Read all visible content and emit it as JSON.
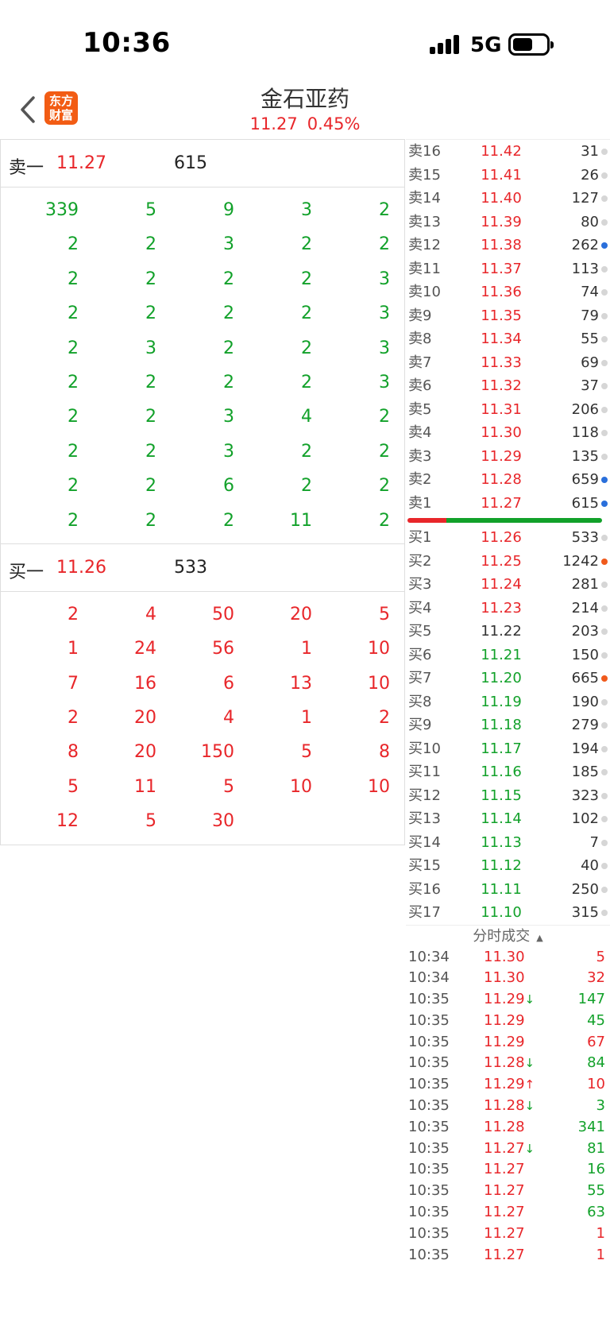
{
  "status_bar": {
    "time": "10:36",
    "network": "5G"
  },
  "header": {
    "logo_line1": "东方",
    "logo_line2": "财富",
    "stock_name": "金石亚药",
    "price": "11.27",
    "change_pct": "0.45%"
  },
  "sell1": {
    "label": "卖一",
    "price": "11.27",
    "volume": "615"
  },
  "sell_queue": [
    "339",
    "5",
    "9",
    "3",
    "2",
    "2",
    "2",
    "3",
    "2",
    "2",
    "2",
    "2",
    "2",
    "2",
    "3",
    "2",
    "2",
    "2",
    "2",
    "3",
    "2",
    "3",
    "2",
    "2",
    "3",
    "2",
    "2",
    "2",
    "2",
    "3",
    "2",
    "2",
    "3",
    "4",
    "2",
    "2",
    "2",
    "3",
    "2",
    "2",
    "2",
    "2",
    "6",
    "2",
    "2",
    "2",
    "2",
    "2",
    "11",
    "2"
  ],
  "buy1": {
    "label": "买一",
    "price": "11.26",
    "volume": "533"
  },
  "buy_queue": [
    "2",
    "4",
    "50",
    "20",
    "5",
    "1",
    "24",
    "56",
    "1",
    "10",
    "7",
    "16",
    "6",
    "13",
    "10",
    "2",
    "20",
    "4",
    "1",
    "2",
    "8",
    "20",
    "150",
    "5",
    "8",
    "5",
    "11",
    "5",
    "10",
    "10",
    "12",
    "5",
    "30"
  ],
  "asks": [
    {
      "label": "卖16",
      "price": "11.42",
      "vol": "31",
      "dot": "grey"
    },
    {
      "label": "卖15",
      "price": "11.41",
      "vol": "26",
      "dot": "grey"
    },
    {
      "label": "卖14",
      "price": "11.40",
      "vol": "127",
      "dot": "grey"
    },
    {
      "label": "卖13",
      "price": "11.39",
      "vol": "80",
      "dot": "grey"
    },
    {
      "label": "卖12",
      "price": "11.38",
      "vol": "262",
      "dot": "blue"
    },
    {
      "label": "卖11",
      "price": "11.37",
      "vol": "113",
      "dot": "grey"
    },
    {
      "label": "卖10",
      "price": "11.36",
      "vol": "74",
      "dot": "grey"
    },
    {
      "label": "卖9",
      "price": "11.35",
      "vol": "79",
      "dot": "grey"
    },
    {
      "label": "卖8",
      "price": "11.34",
      "vol": "55",
      "dot": "grey"
    },
    {
      "label": "卖7",
      "price": "11.33",
      "vol": "69",
      "dot": "grey"
    },
    {
      "label": "卖6",
      "price": "11.32",
      "vol": "37",
      "dot": "grey"
    },
    {
      "label": "卖5",
      "price": "11.31",
      "vol": "206",
      "dot": "grey"
    },
    {
      "label": "卖4",
      "price": "11.30",
      "vol": "118",
      "dot": "grey"
    },
    {
      "label": "卖3",
      "price": "11.29",
      "vol": "135",
      "dot": "grey"
    },
    {
      "label": "卖2",
      "price": "11.28",
      "vol": "659",
      "dot": "blue"
    },
    {
      "label": "卖1",
      "price": "11.27",
      "vol": "615",
      "dot": "blue"
    }
  ],
  "bids": [
    {
      "label": "买1",
      "price": "11.26",
      "vol": "533",
      "dot": "grey",
      "color": "red"
    },
    {
      "label": "买2",
      "price": "11.25",
      "vol": "1242",
      "dot": "orange",
      "color": "red"
    },
    {
      "label": "买3",
      "price": "11.24",
      "vol": "281",
      "dot": "grey",
      "color": "red"
    },
    {
      "label": "买4",
      "price": "11.23",
      "vol": "214",
      "dot": "grey",
      "color": "red"
    },
    {
      "label": "买5",
      "price": "11.22",
      "vol": "203",
      "dot": "grey",
      "color": "dark"
    },
    {
      "label": "买6",
      "price": "11.21",
      "vol": "150",
      "dot": "grey",
      "color": "green"
    },
    {
      "label": "买7",
      "price": "11.20",
      "vol": "665",
      "dot": "orange",
      "color": "green"
    },
    {
      "label": "买8",
      "price": "11.19",
      "vol": "190",
      "dot": "grey",
      "color": "green"
    },
    {
      "label": "买9",
      "price": "11.18",
      "vol": "279",
      "dot": "grey",
      "color": "green"
    },
    {
      "label": "买10",
      "price": "11.17",
      "vol": "194",
      "dot": "grey",
      "color": "green"
    },
    {
      "label": "买11",
      "price": "11.16",
      "vol": "185",
      "dot": "grey",
      "color": "green"
    },
    {
      "label": "买12",
      "price": "11.15",
      "vol": "323",
      "dot": "grey",
      "color": "green"
    },
    {
      "label": "买13",
      "price": "11.14",
      "vol": "102",
      "dot": "grey",
      "color": "green"
    },
    {
      "label": "买14",
      "price": "11.13",
      "vol": "7",
      "dot": "grey",
      "color": "green"
    },
    {
      "label": "买15",
      "price": "11.12",
      "vol": "40",
      "dot": "grey",
      "color": "green"
    },
    {
      "label": "买16",
      "price": "11.11",
      "vol": "250",
      "dot": "grey",
      "color": "green"
    },
    {
      "label": "买17",
      "price": "11.10",
      "vol": "315",
      "dot": "grey",
      "color": "green"
    }
  ],
  "ticks_title": "分时成交",
  "ticks": [
    {
      "time": "10:34",
      "price": "11.30",
      "arrow": "",
      "vol": "5",
      "vol_color": "red"
    },
    {
      "time": "10:34",
      "price": "11.30",
      "arrow": "",
      "vol": "32",
      "vol_color": "red"
    },
    {
      "time": "10:35",
      "price": "11.29",
      "arrow": "↓",
      "vol": "147",
      "vol_color": "green"
    },
    {
      "time": "10:35",
      "price": "11.29",
      "arrow": "",
      "vol": "45",
      "vol_color": "green"
    },
    {
      "time": "10:35",
      "price": "11.29",
      "arrow": "",
      "vol": "67",
      "vol_color": "red"
    },
    {
      "time": "10:35",
      "price": "11.28",
      "arrow": "↓",
      "vol": "84",
      "vol_color": "green"
    },
    {
      "time": "10:35",
      "price": "11.29",
      "arrow": "↑",
      "vol": "10",
      "vol_color": "red"
    },
    {
      "time": "10:35",
      "price": "11.28",
      "arrow": "↓",
      "vol": "3",
      "vol_color": "green"
    },
    {
      "time": "10:35",
      "price": "11.28",
      "arrow": "",
      "vol": "341",
      "vol_color": "green"
    },
    {
      "time": "10:35",
      "price": "11.27",
      "arrow": "↓",
      "vol": "81",
      "vol_color": "green"
    },
    {
      "time": "10:35",
      "price": "11.27",
      "arrow": "",
      "vol": "16",
      "vol_color": "green"
    },
    {
      "time": "10:35",
      "price": "11.27",
      "arrow": "",
      "vol": "55",
      "vol_color": "green"
    },
    {
      "time": "10:35",
      "price": "11.27",
      "arrow": "",
      "vol": "63",
      "vol_color": "green"
    },
    {
      "time": "10:35",
      "price": "11.27",
      "arrow": "",
      "vol": "1",
      "vol_color": "red"
    },
    {
      "time": "10:35",
      "price": "11.27",
      "arrow": "",
      "vol": "1",
      "vol_color": "red"
    }
  ],
  "colors": {
    "up": "#e8262a",
    "down": "#12a12a",
    "blue_dot": "#2a6fdb",
    "orange_dot": "#f05a1c",
    "grey_dot": "#d6d6d6"
  }
}
